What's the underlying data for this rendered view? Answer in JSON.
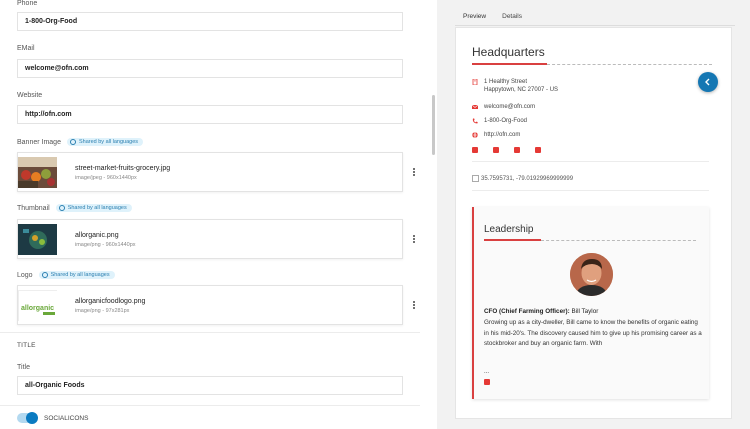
{
  "form": {
    "phone": {
      "label": "Phone",
      "value": "1-800-Org-Food"
    },
    "email": {
      "label": "EMail",
      "value": "welcome@ofn.com"
    },
    "website": {
      "label": "Website",
      "value": "http://ofn.com"
    },
    "shared_badge": "Shared by all languages",
    "banner": {
      "label": "Banner Image",
      "file_name": "street-market-fruits-grocery.jpg",
      "file_meta": "image/jpeg - 960x1440px"
    },
    "thumbnail": {
      "label": "Thumbnail",
      "file_name": "allorganic.png",
      "file_meta": "image/png - 960x1440px"
    },
    "logo": {
      "label": "Logo",
      "file_name": "allorganicfoodlogo.png",
      "file_meta": "image/png - 97x281px",
      "logo_text": "allorganic"
    },
    "title_section": "TITLE",
    "title": {
      "label": "Title",
      "value": "all-Organic Foods"
    },
    "socialicons_label": "SOCIALICONS"
  },
  "preview": {
    "tabs": [
      "Preview",
      "Details"
    ],
    "active_tab": "Preview",
    "headquarters_title": "Headquarters",
    "address_line1": "1 Healthy Street",
    "address_line2": "Happytown, NC 27007 - US",
    "email": "welcome@ofn.com",
    "phone": "1-800-Org-Food",
    "website": "http://ofn.com",
    "map_alt": "35.7595731, -79.01929969999999",
    "leadership_title": "Leadership",
    "leader_role": "CFO (Chief Farming Officer):",
    "leader_name": "Bill Taylor",
    "leader_bio": "Growing up as a city-dweller, Bill came to know the benefits of organic eating in his mid-20's. The discovery caused him to give up his promising career as a stockbroker and buy an organic farm. With",
    "leader_more": "...",
    "social_icons": [
      "facebook-icon",
      "twitter-icon",
      "google-plus-icon",
      "linkedin-icon"
    ]
  },
  "colors": {
    "accent_red": "#d94040",
    "accent_blue": "#1577b3",
    "badge_bg": "#dff2fb"
  }
}
